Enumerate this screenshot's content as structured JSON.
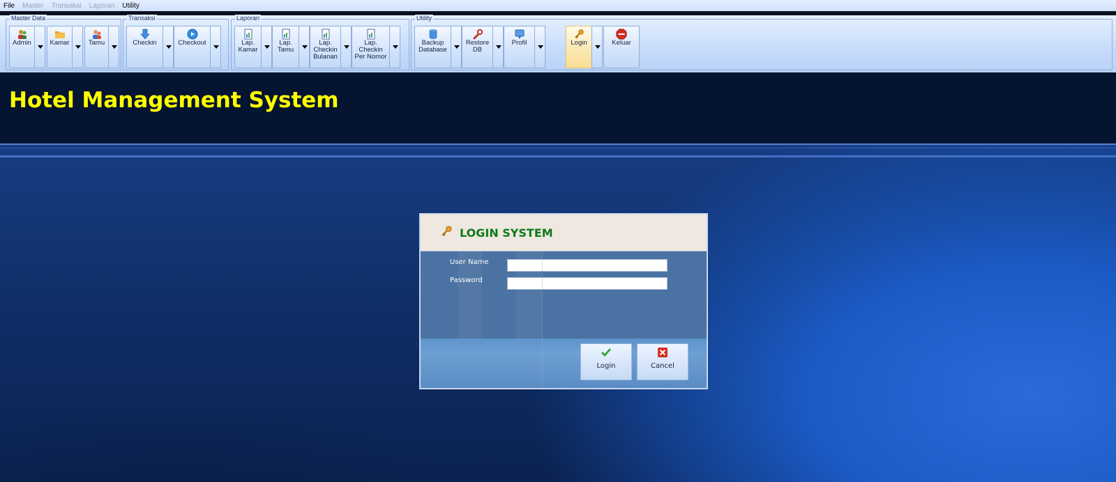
{
  "menubar": [
    {
      "label": "File",
      "enabled": true
    },
    {
      "label": "Master",
      "enabled": false
    },
    {
      "label": "Transaksi",
      "enabled": false
    },
    {
      "label": "Laporan",
      "enabled": false
    },
    {
      "label": "Utility",
      "enabled": true
    }
  ],
  "ribbon": {
    "master_data": {
      "title": "Master Data",
      "admin": "Admin",
      "kamar": "Kamar",
      "tamu": "Tamu"
    },
    "transaksi": {
      "title": "Transaksi",
      "checkin": "Checkin",
      "checkout": "Checkout"
    },
    "laporan": {
      "title": "Laporan",
      "lap_kamar": "Lap.\nKamar",
      "lap_tamu": "Lap.\nTamu",
      "lap_checkin_bulanan": "Lap.\nCheckin\nBulanan",
      "lap_checkin_per_nomor": "Lap.\nCheckin\nPer Nomor"
    },
    "utility": {
      "title": "Utility",
      "backup_database": "Backup\nDatabase",
      "restore_db": "Restore\nDB",
      "profil": "Profil"
    },
    "login": "Login",
    "keluar": "Keluar"
  },
  "header": {
    "title": "Hotel Management System"
  },
  "login_dialog": {
    "title": "LOGIN SYSTEM",
    "username_label": "User Name",
    "username_value": "",
    "password_label": "Password",
    "password_value": "",
    "login_button": "Login",
    "cancel_button": "Cancel"
  },
  "colors": {
    "title_yellow": "#ffff00",
    "dialog_title_green": "#0c7a1b",
    "header_bg": "#051430"
  }
}
